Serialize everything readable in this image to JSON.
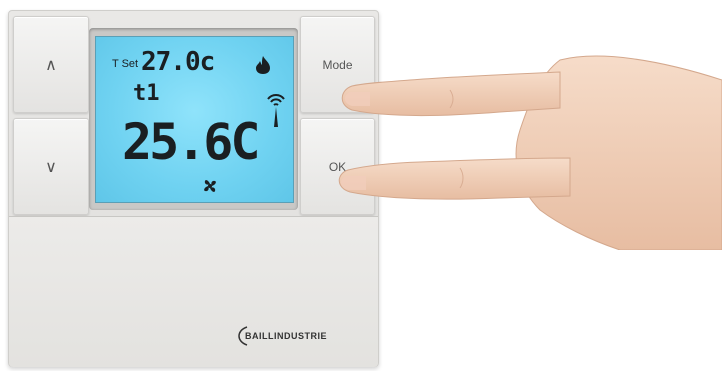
{
  "buttons": {
    "up_symbol": "∧",
    "down_symbol": "∨",
    "mode_label": "Mode",
    "ok_label": "OK"
  },
  "display": {
    "setpoint_label": "T Set",
    "setpoint_value": "27.0c",
    "program_label": "t1",
    "current_temp": "25.6C",
    "icons": [
      "flame-icon",
      "wifi-signal-icon",
      "fan-icon"
    ]
  },
  "brand": "BAILLINDUSTRIE",
  "colors": {
    "lcd_background": "#6fd2f1",
    "lcd_segments": "#1a1f22",
    "device_body": "#e6e5e3"
  }
}
